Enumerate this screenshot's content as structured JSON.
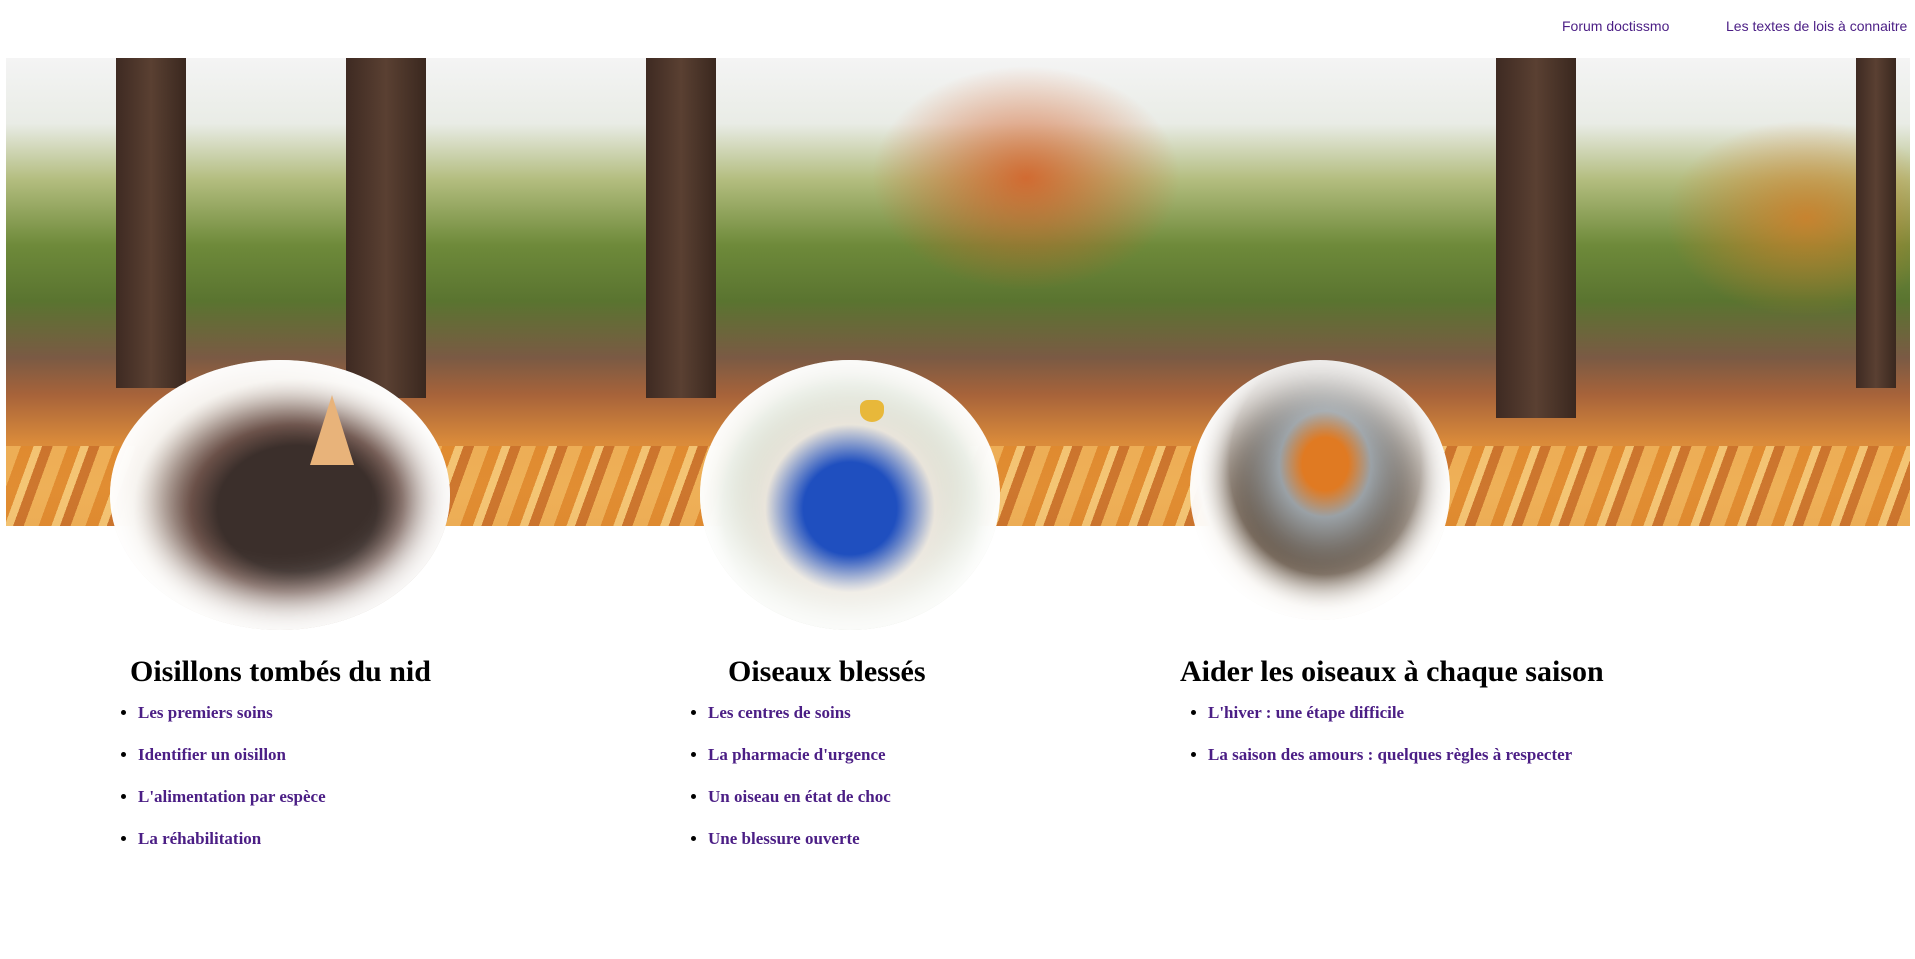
{
  "top_nav": {
    "forum": "Forum doctissmo",
    "laws": "Les textes de lois à connaitre"
  },
  "sections": [
    {
      "title": "Oisillons tombés du nid",
      "links": [
        "Les premiers soins",
        "Identifier un oisillon",
        "L'alimentation par espèce",
        "La réhabilitation"
      ]
    },
    {
      "title": "Oiseaux blessés",
      "links": [
        "Les centres de soins",
        "La pharmacie d'urgence",
        "Un oiseau en état de choc",
        "Une blessure ouverte"
      ]
    },
    {
      "title": "Aider les oiseaux à chaque saison",
      "links": [
        "L'hiver : une étape difficile",
        "La saison des amours : quelques règles à respecter"
      ]
    }
  ],
  "colors": {
    "link": "#4b1e85",
    "heading": "#000000"
  }
}
